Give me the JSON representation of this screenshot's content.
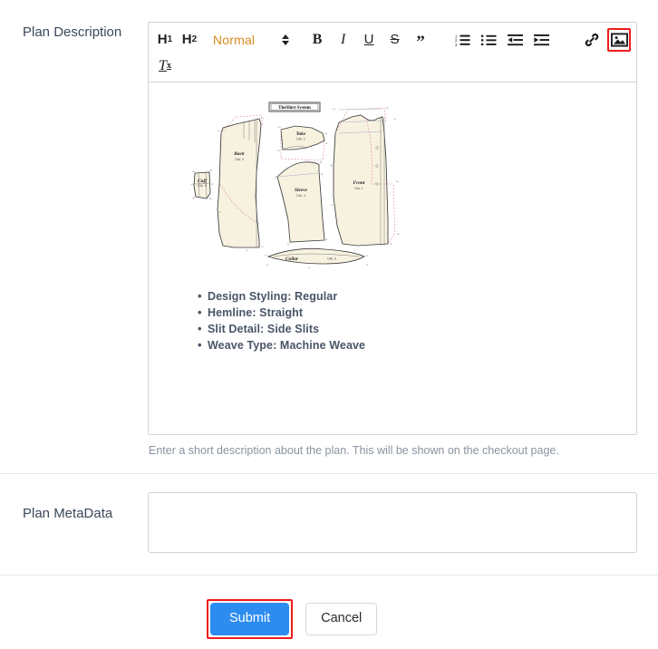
{
  "form": {
    "description_label": "Plan Description",
    "description_helper": "Enter a short description about the plan. This will be shown on the checkout page.",
    "metadata_label": "Plan MetaData",
    "metadata_value": "",
    "metadata_placeholder": ""
  },
  "toolbar": {
    "h1_label": "H",
    "h1_sub": "1",
    "h2_label": "H",
    "h2_sub": "2",
    "format_value": "Normal",
    "format_color": "#d98b1f",
    "bold_label": "B",
    "italic_label": "I",
    "underline_label": "U",
    "strike_label": "S",
    "quote_label": "”",
    "ordered_list_name": "ordered-list",
    "bullet_list_name": "bullet-list",
    "outdent_name": "outdent",
    "indent_name": "indent",
    "link_name": "link",
    "image_name": "image",
    "clear_format_label": "T",
    "clear_format_sub": "x",
    "highlight_color": "#f01c1c"
  },
  "editor_content": {
    "diagram": {
      "title": "TheShirt System",
      "pieces": [
        {
          "name": "Back",
          "dia": "DIA. 3"
        },
        {
          "name": "Yoke",
          "dia": "DIA. 2"
        },
        {
          "name": "Sleeve",
          "dia": "DIA. 4"
        },
        {
          "name": "Front",
          "dia": "DIA. 1"
        },
        {
          "name": "Cuff",
          "dia": "DIA. 5"
        },
        {
          "name": "Collar",
          "dia": "DIA. 6"
        }
      ],
      "paper_color": "#f7f2e0",
      "outline_color": "#3a3a3a",
      "guide_color": "#d9889a"
    },
    "bullets": [
      "Design Styling: Regular",
      "Hemline: Straight",
      "Slit Detail: Side Slits",
      "Weave Type: Machine Weave"
    ]
  },
  "actions": {
    "submit_label": "Submit",
    "cancel_label": "Cancel",
    "submit_color": "#2d8cf0",
    "submit_highlight_color": "#f01c1c"
  }
}
